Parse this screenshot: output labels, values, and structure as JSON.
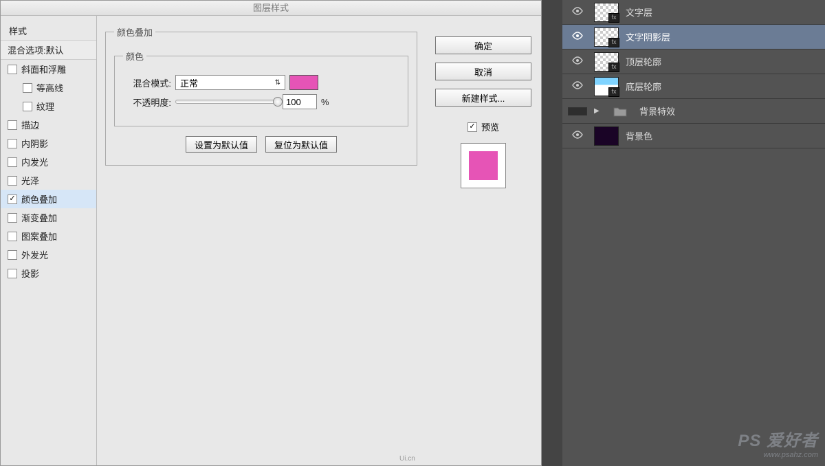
{
  "dialog": {
    "title": "图层样式",
    "styles_header": "样式",
    "blend_options": "混合选项:默认",
    "style_items": {
      "bevel": "斜面和浮雕",
      "contour": "等高线",
      "texture": "纹理",
      "stroke": "描边",
      "inner_shadow": "内阴影",
      "inner_glow": "内发光",
      "satin": "光泽",
      "color_overlay": "颜色叠加",
      "gradient_overlay": "渐变叠加",
      "pattern_overlay": "图案叠加",
      "outer_glow": "外发光",
      "drop_shadow": "投影"
    },
    "center": {
      "group_title": "颜色叠加",
      "subgroup_title": "颜色",
      "blend_mode_label": "混合模式:",
      "blend_mode_value": "正常",
      "opacity_label": "不透明度:",
      "opacity_value": "100",
      "opacity_unit": "%",
      "swatch_color": "#e654b6",
      "set_default": "设置为默认值",
      "reset_default": "复位为默认值"
    },
    "right": {
      "ok": "确定",
      "cancel": "取消",
      "new_style": "新建样式...",
      "preview": "预览",
      "preview_color": "#e654b6"
    }
  },
  "layers": {
    "items": {
      "text_layer": "文字层",
      "text_shadow_layer": "文字阴影层",
      "top_outline": "顶层轮廓",
      "bottom_outline": "底层轮廓",
      "bg_effects": "背景特效",
      "bg_color": "背景色"
    }
  },
  "watermark": {
    "text": "PS 爱好者",
    "url": "www.psahz.com"
  },
  "footer": "Ui.cn"
}
